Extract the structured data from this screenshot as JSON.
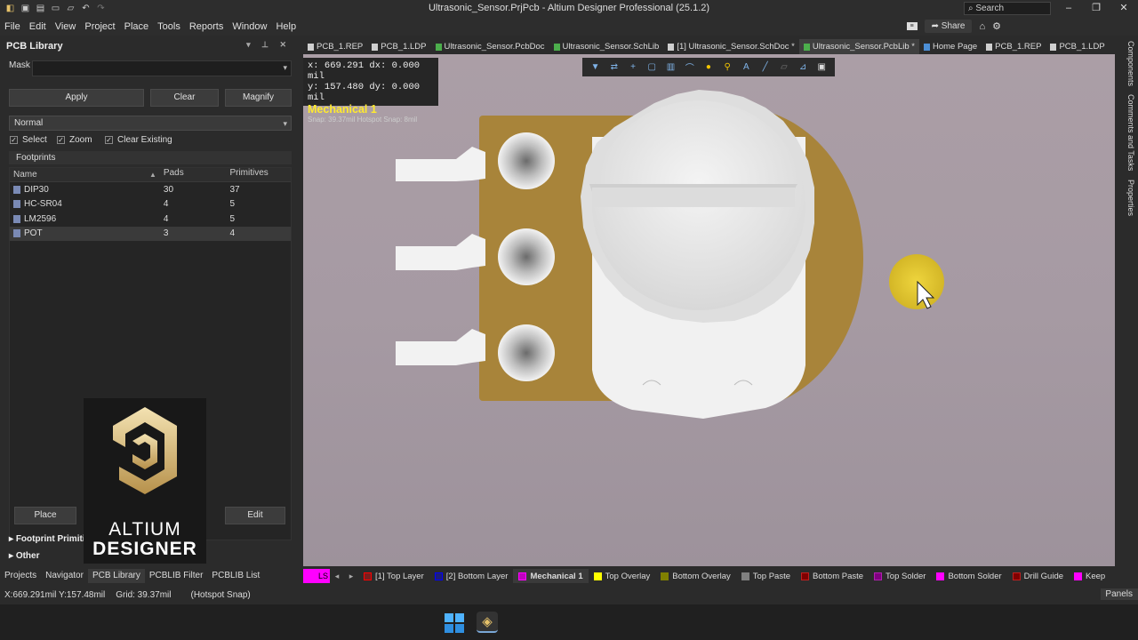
{
  "window": {
    "title": "Ultrasonic_Sensor.PrjPcb - Altium Designer Professional (25.1.2)",
    "search_placeholder": "Search"
  },
  "menu": {
    "items": [
      "File",
      "Edit",
      "View",
      "Project",
      "Place",
      "Tools",
      "Reports",
      "Window",
      "Help"
    ],
    "share": "Share"
  },
  "panel": {
    "title": "PCB Library",
    "mask_label": "Mask",
    "apply": "Apply",
    "clear": "Clear",
    "magnify": "Magnify",
    "mode": "Normal",
    "checks": [
      "Select",
      "Zoom",
      "Clear Existing"
    ],
    "footprints_title": "Footprints",
    "columns": [
      "Name",
      "Pads",
      "Primitives"
    ],
    "rows": [
      {
        "name": "DIP30",
        "pads": "30",
        "primitives": "37"
      },
      {
        "name": "HC-SR04",
        "pads": "4",
        "primitives": "5"
      },
      {
        "name": "LM2596",
        "pads": "4",
        "primitives": "5"
      },
      {
        "name": "POT",
        "pads": "3",
        "primitives": "4"
      }
    ],
    "place": "Place",
    "edit": "Edit",
    "footprint_primitives": "Footprint Primitives",
    "other": "Other"
  },
  "logo": {
    "line1": "ALTIUM",
    "line2": "DESIGNER"
  },
  "bottom_tabs": [
    "Projects",
    "Navigator",
    "PCB Library",
    "PCBLIB Filter",
    "PCBLIB List"
  ],
  "doc_tabs": [
    {
      "label": "PCB_1.REP",
      "color": "#cfcfcf"
    },
    {
      "label": "PCB_1.LDP",
      "color": "#cfcfcf"
    },
    {
      "label": "Ultrasonic_Sensor.PcbDoc",
      "color": "#4cae4c"
    },
    {
      "label": "Ultrasonic_Sensor.SchLib",
      "color": "#4cae4c"
    },
    {
      "label": "[1] Ultrasonic_Sensor.SchDoc *",
      "color": "#cfcfcf"
    },
    {
      "label": "Ultrasonic_Sensor.PcbLib *",
      "color": "#4cae4c"
    },
    {
      "label": "Home Page",
      "color": "#4c8fd6"
    },
    {
      "label": "PCB_1.REP",
      "color": "#cfcfcf"
    },
    {
      "label": "PCB_1.LDP",
      "color": "#cfcfcf"
    }
  ],
  "coords": {
    "x_label": "x:",
    "x": "669.291",
    "dx_label": "dx:",
    "dx": "0.000 mil",
    "y_label": "y:",
    "y": "157.480",
    "dy_label": "dy:",
    "dy": "0.000 mil",
    "layer": "Mechanical 1",
    "snap": "Snap: 39.37mil Hotspot Snap: 8mil"
  },
  "right_tabs": [
    "Components",
    "Comments and Tasks",
    "Properties"
  ],
  "layer_bar": {
    "ls": "LS",
    "layers": [
      {
        "name": "[1] Top Layer",
        "color": "#ff0000"
      },
      {
        "name": "[2] Bottom Layer",
        "color": "#0000ff"
      },
      {
        "name": "Mechanical 1",
        "color": "#ff00ff",
        "active": true
      },
      {
        "name": "Top Overlay",
        "color": "#ffff00"
      },
      {
        "name": "Bottom Overlay",
        "color": "#808000"
      },
      {
        "name": "Top Paste",
        "color": "#808080"
      },
      {
        "name": "Bottom Paste",
        "color": "#800000"
      },
      {
        "name": "Top Solder",
        "color": "#800080"
      },
      {
        "name": "Bottom Solder",
        "color": "#ff00ff"
      },
      {
        "name": "Drill Guide",
        "color": "#800000"
      },
      {
        "name": "Keep",
        "color": "#ff00ff"
      }
    ]
  },
  "status": {
    "position": "X:669.291mil Y:157.48mil",
    "grid": "Grid: 39.37mil",
    "snap": "(Hotspot Snap)",
    "panels": "Panels"
  }
}
